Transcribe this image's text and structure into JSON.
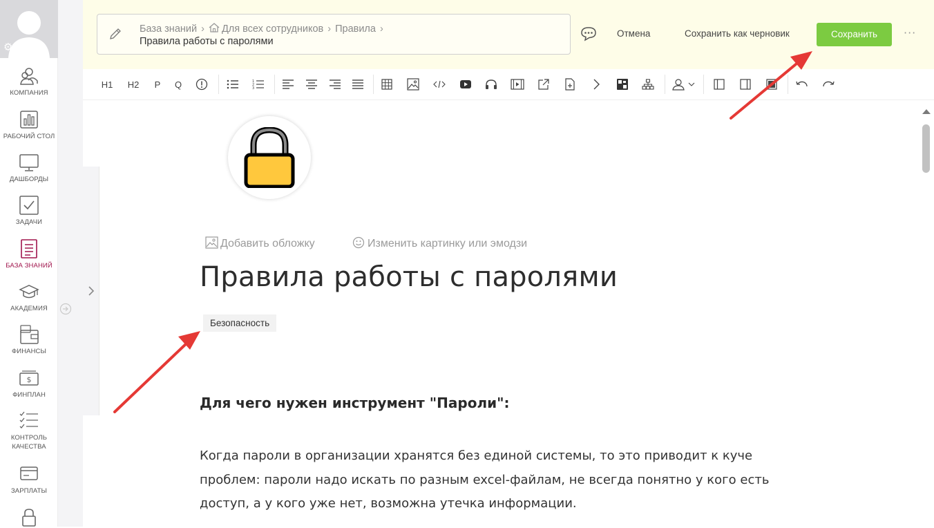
{
  "nav": {
    "items": [
      {
        "label": "КОМПАНИЯ",
        "icon": "company-icon"
      },
      {
        "label": "РАБОЧИЙ СТОЛ",
        "icon": "desktop-chart-icon"
      },
      {
        "label": "ДАШБОРДЫ",
        "icon": "monitor-icon"
      },
      {
        "label": "ЗАДАЧИ",
        "icon": "checkbox-icon"
      },
      {
        "label": "БАЗА ЗНАНИЙ",
        "icon": "document-icon",
        "active": true
      },
      {
        "label": "АКАДЕМИЯ",
        "icon": "graduation-cap-icon"
      },
      {
        "label": "ФИНАНСЫ",
        "icon": "wallet-icon"
      },
      {
        "label": "ФИНПЛАН",
        "icon": "money-icon"
      },
      {
        "label": "КОНТРОЛЬ КАЧЕСТВА",
        "icon": "checklist-icon"
      },
      {
        "label": "ЗАРПЛАТЫ",
        "icon": "card-icon"
      },
      {
        "label": "",
        "icon": "lock-icon"
      }
    ],
    "active_color": "#a0144c"
  },
  "header": {
    "breadcrumbs": [
      "База знаний",
      "Для всех сотрудников",
      "Правила"
    ],
    "current": "Правила работы с паролями",
    "cancel_label": "Отмена",
    "draft_label": "Сохранить как черновик",
    "save_label": "Сохранить",
    "more_label": "···",
    "save_color": "#7ccb41",
    "background": "#fefde8"
  },
  "toolbar": {
    "h1": "H1",
    "h2": "H2",
    "p": "P",
    "q": "Q"
  },
  "article": {
    "add_cover": "Добавить обложку",
    "change_icon": "Изменить картинку или эмодзи",
    "title": "Правила работы с паролями",
    "tag": "Безопасность",
    "heading": "Для чего нужен инструмент \"Пароли\":",
    "paragraph": "Когда пароли в организации хранятся без единой системы, то это приводит к куче проблем: пароли надо искать по разным excel-файлам, не всегда понятно у кого есть доступ, а у кого уже нет, возможна утечка информации.",
    "cover_emoji": "lock-emoji"
  },
  "annotation_color": "#e53935"
}
